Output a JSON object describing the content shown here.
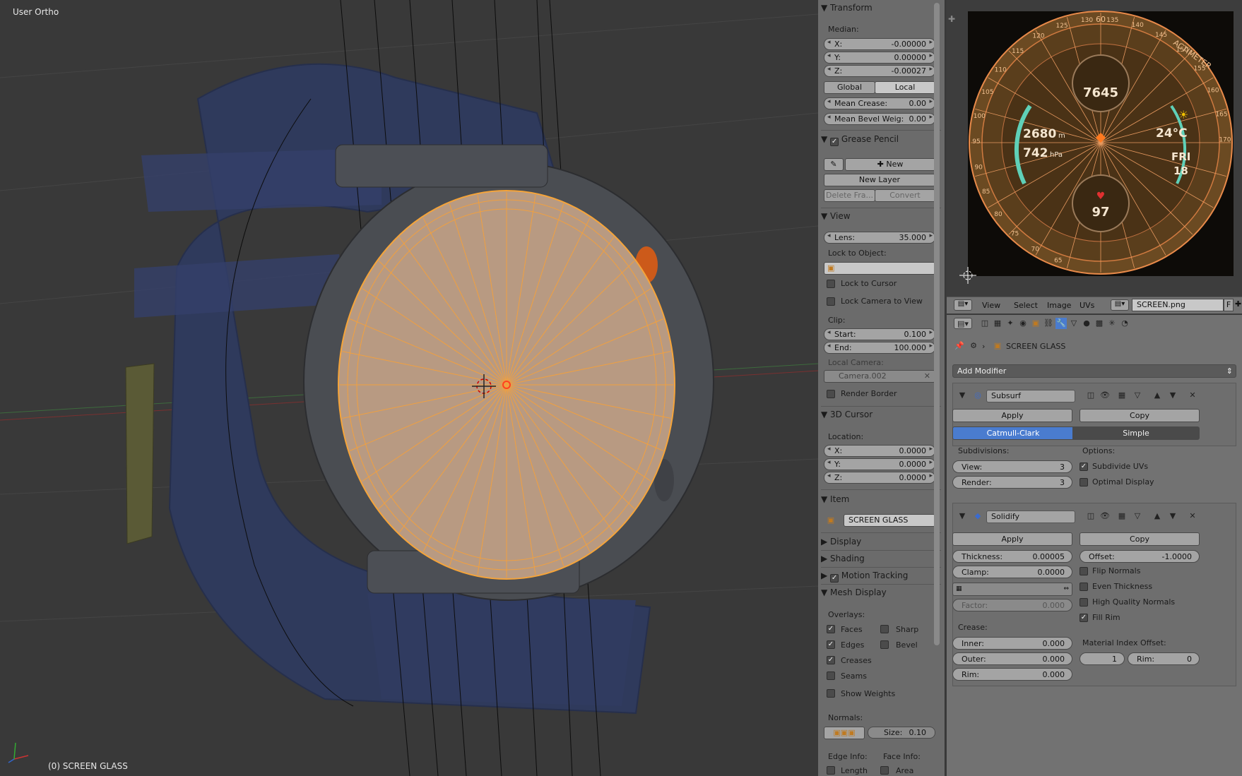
{
  "viewport": {
    "title": "User Ortho",
    "footer": "(0) SCREEN GLASS"
  },
  "transform": {
    "title": "Transform",
    "median_label": "Median:",
    "x_key": "X:",
    "x": "-0.00000",
    "y_key": "Y:",
    "y": "0.00000",
    "z_key": "Z:",
    "z": "-0.00027",
    "global": "Global",
    "local": "Local",
    "mean_crease_key": "Mean Crease:",
    "mean_crease": "0.00",
    "mean_bevel_key": "Mean Bevel Weig:",
    "mean_bevel": "0.00"
  },
  "grease_pencil": {
    "title": "Grease Pencil",
    "new": "New",
    "new_layer": "New Layer",
    "delete_frame": "Delete Fra...",
    "convert": "Convert"
  },
  "view": {
    "title": "View",
    "lens_key": "Lens:",
    "lens": "35.000",
    "lock_to_object": "Lock to Object:",
    "lock_to_cursor": "Lock to Cursor",
    "lock_camera": "Lock Camera to View",
    "clip": "Clip:",
    "start_key": "Start:",
    "start": "0.100",
    "end_key": "End:",
    "end": "100.000",
    "local_camera": "Local Camera:",
    "camera": "Camera.002",
    "render_border": "Render Border"
  },
  "cursor": {
    "title": "3D Cursor",
    "location": "Location:",
    "x_key": "X:",
    "x": "0.0000",
    "y_key": "Y:",
    "y": "0.0000",
    "z_key": "Z:",
    "z": "0.0000"
  },
  "item": {
    "title": "Item",
    "name": "SCREEN GLASS"
  },
  "collapsed": {
    "display": "Display",
    "shading": "Shading",
    "motion_tracking": "Motion Tracking"
  },
  "mesh_display": {
    "title": "Mesh Display",
    "overlays": "Overlays:",
    "faces": "Faces",
    "sharp": "Sharp",
    "edges": "Edges",
    "bevel": "Bevel",
    "creases": "Creases",
    "seams": "Seams",
    "show_weights": "Show Weights",
    "normals": "Normals:",
    "size_key": "Size:",
    "size": "0.10",
    "edge_info": "Edge Info:",
    "face_info": "Face Info:",
    "length": "Length",
    "area": "Area"
  },
  "uv_header": {
    "view": "View",
    "select": "Select",
    "image": "Image",
    "uvs": "UVs",
    "image_name": "SCREEN.png",
    "f": "F"
  },
  "watch_face": {
    "steps": "7645",
    "altitude": "2680",
    "altitude_unit": "m",
    "pressure": "742",
    "pressure_unit": "hPa",
    "temperature": "24°C",
    "day": "FRI",
    "date": "18",
    "heart_rate": "97",
    "bezel_top": "60",
    "bezel_word": "ACTIMETER",
    "bezel_numbers": [
      "65",
      "70",
      "75",
      "80",
      "85",
      "90",
      "95",
      "100",
      "105",
      "110",
      "115",
      "120",
      "125",
      "130",
      "135",
      "140",
      "145",
      "150",
      "155",
      "160",
      "165",
      "170"
    ]
  },
  "properties": {
    "object": "SCREEN GLASS",
    "add_modifier": "Add Modifier",
    "subsurf": {
      "name": "Subsurf",
      "apply": "Apply",
      "copy": "Copy",
      "catmull": "Catmull-Clark",
      "simple": "Simple",
      "subdivisions": "Subdivisions:",
      "options": "Options:",
      "view_key": "View:",
      "view": "3",
      "render_key": "Render:",
      "render": "3",
      "subdivide_uvs": "Subdivide UVs",
      "optimal_display": "Optimal Display"
    },
    "solidify": {
      "name": "Solidify",
      "apply": "Apply",
      "copy": "Copy",
      "thickness_key": "Thickness:",
      "thickness": "0.00005",
      "offset_key": "Offset:",
      "offset": "-1.0000",
      "clamp_key": "Clamp:",
      "clamp": "0.0000",
      "flip_normals": "Flip Normals",
      "even_thickness": "Even Thickness",
      "high_quality": "High Quality Normals",
      "fill_rim": "Fill Rim",
      "factor_key": "Factor:",
      "factor": "0.000",
      "crease": "Crease:",
      "inner_key": "Inner:",
      "inner": "0.000",
      "outer_key": "Outer:",
      "outer": "0.000",
      "rim_key": "Rim:",
      "rim": "0.000",
      "mat_index": "Material Index Offset:",
      "mat_val": "1",
      "mat_rim_key": "Rim:",
      "mat_rim": "0"
    }
  },
  "colors": {
    "selection": "#f5a43a",
    "active": "#4a7ccf",
    "strap": "#2f3a5c"
  }
}
